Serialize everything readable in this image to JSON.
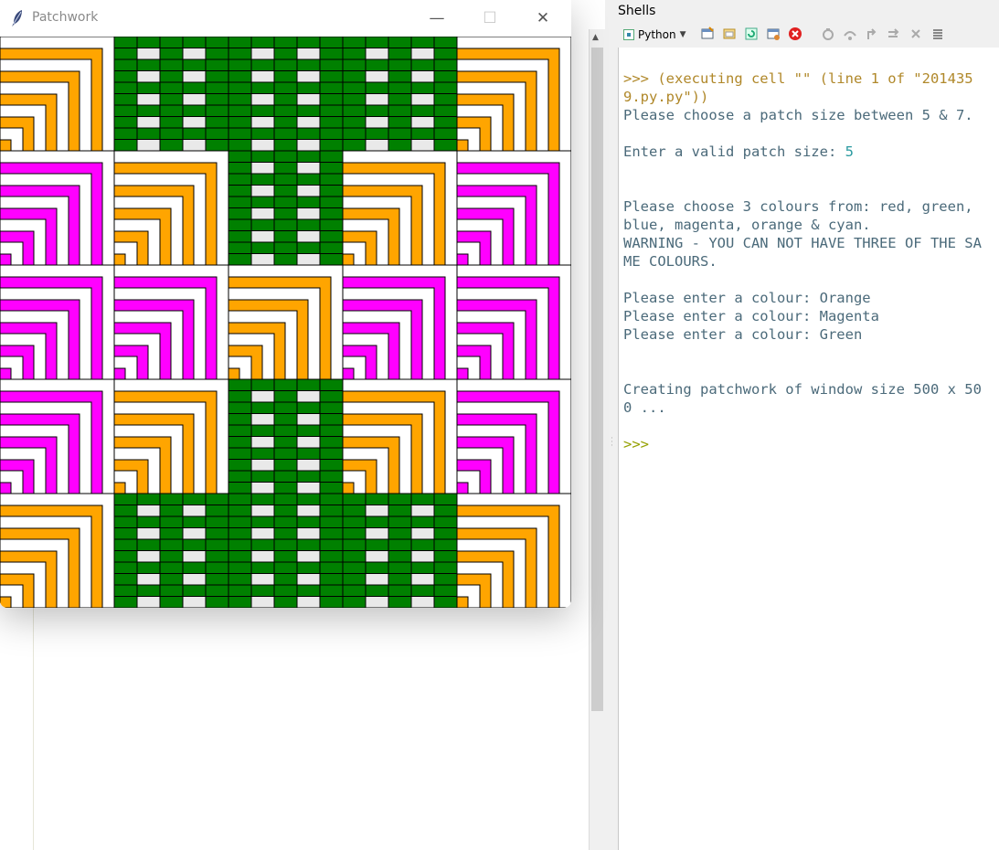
{
  "shells": {
    "title": "Shells",
    "interpreter": "Python",
    "lines": [
      {
        "cls": "exec",
        "text": ">>> (executing cell \"\" (line 1 of \"2014359.py.py\"))"
      },
      {
        "cls": "",
        "text": "Please choose a patch size between 5 & 7."
      },
      {
        "cls": "",
        "text": ""
      },
      {
        "cls": "",
        "text": "Enter a valid patch size: ",
        "input": "5"
      },
      {
        "cls": "",
        "text": ""
      },
      {
        "cls": "",
        "text": ""
      },
      {
        "cls": "",
        "text": "Please choose 3 colours from: red, green, blue, magenta, orange & cyan."
      },
      {
        "cls": "",
        "text": "WARNING - YOU CAN NOT HAVE THREE OF THE SAME COLOURS."
      },
      {
        "cls": "",
        "text": ""
      },
      {
        "cls": "",
        "text": "Please enter a colour: Orange"
      },
      {
        "cls": "",
        "text": "Please enter a colour: Magenta"
      },
      {
        "cls": "",
        "text": "Please enter a colour: Green"
      },
      {
        "cls": "",
        "text": ""
      },
      {
        "cls": "",
        "text": ""
      },
      {
        "cls": "",
        "text": "Creating patchwork of window size 500 x 500 ..."
      },
      {
        "cls": "",
        "text": ""
      },
      {
        "cls": "prompt",
        "text": ">>>"
      }
    ],
    "toolbar_icons": [
      "new-shell-icon",
      "open-icon",
      "restart-icon",
      "interrupt-icon",
      "stop-icon",
      "debug-icon",
      "step-over-icon",
      "step-into-icon",
      "step-out-icon",
      "resume-icon",
      "clear-icon",
      "menu-icon"
    ]
  },
  "tkwindow": {
    "title": "Patchwork",
    "minimize": "—",
    "maximize": "☐",
    "close": "✕"
  },
  "patchwork": {
    "patch_size": 5,
    "window_size": 500,
    "colours": {
      "orange": "#ffa500",
      "magenta": "#ff00ff",
      "green": "#008000",
      "white": "#ffffff",
      "gap": "#e9e9e9"
    },
    "grid": [
      [
        "orange",
        "green",
        "green",
        "green",
        "orange"
      ],
      [
        "magenta",
        "orange",
        "green",
        "orange",
        "magenta"
      ],
      [
        "magenta",
        "magenta",
        "orange",
        "magenta",
        "magenta"
      ],
      [
        "magenta",
        "orange",
        "green",
        "orange",
        "magenta"
      ],
      [
        "orange",
        "green",
        "green",
        "green",
        "orange"
      ]
    ]
  }
}
